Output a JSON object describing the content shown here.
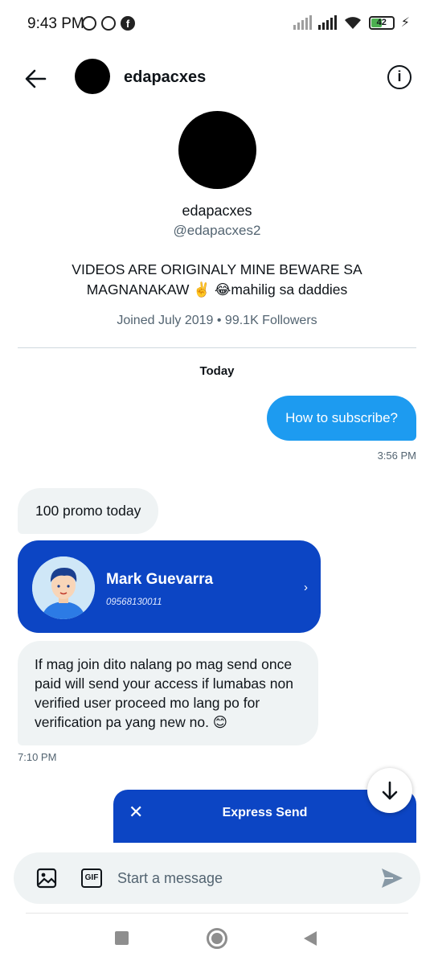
{
  "status_bar": {
    "time": "9:43 PM",
    "battery": "42",
    "left_icons": [
      "alarm-icon",
      "viber-icon",
      "facebook-icon"
    ],
    "right_icons": [
      "signal-icon",
      "signal-icon",
      "wifi-icon",
      "battery-icon",
      "charging-icon"
    ]
  },
  "header": {
    "name": "edapacxes",
    "back_icon": "arrow-left-icon",
    "info_icon": "info-icon"
  },
  "profile": {
    "display_name": "edapacxes",
    "handle": "@edapacxes2",
    "bio": "VIDEOS ARE ORIGINALY MINE BEWARE SA MAGNANAKAW ✌️ 😂mahilig sa daddies",
    "meta": "Joined July 2019 • 99.1K Followers"
  },
  "conversation": {
    "day_label": "Today",
    "messages": [
      {
        "direction": "out",
        "text": "How to subscribe?",
        "time": "3:56 PM"
      },
      {
        "direction": "in",
        "text": "100 promo today"
      },
      {
        "direction": "in",
        "type": "contact-card",
        "name": "Mark Guevarra",
        "number": "09568130011"
      },
      {
        "direction": "in",
        "text": "If mag join dito nalang po mag send once paid will send your access if lumabas non verified user proceed mo lang po for verification pa yang new no. 😊",
        "time": "7:10 PM"
      }
    ]
  },
  "express_send": {
    "title": "Express Send",
    "close_icon": "close-icon"
  },
  "composer": {
    "placeholder": "Start a message",
    "gif_label": "GIF",
    "image_icon": "image-icon",
    "send_icon": "send-icon"
  },
  "colors": {
    "accent": "#1d9bf0",
    "card_blue": "#0c45c4",
    "bubble_grey": "#eff3f4",
    "muted_text": "#536471"
  }
}
